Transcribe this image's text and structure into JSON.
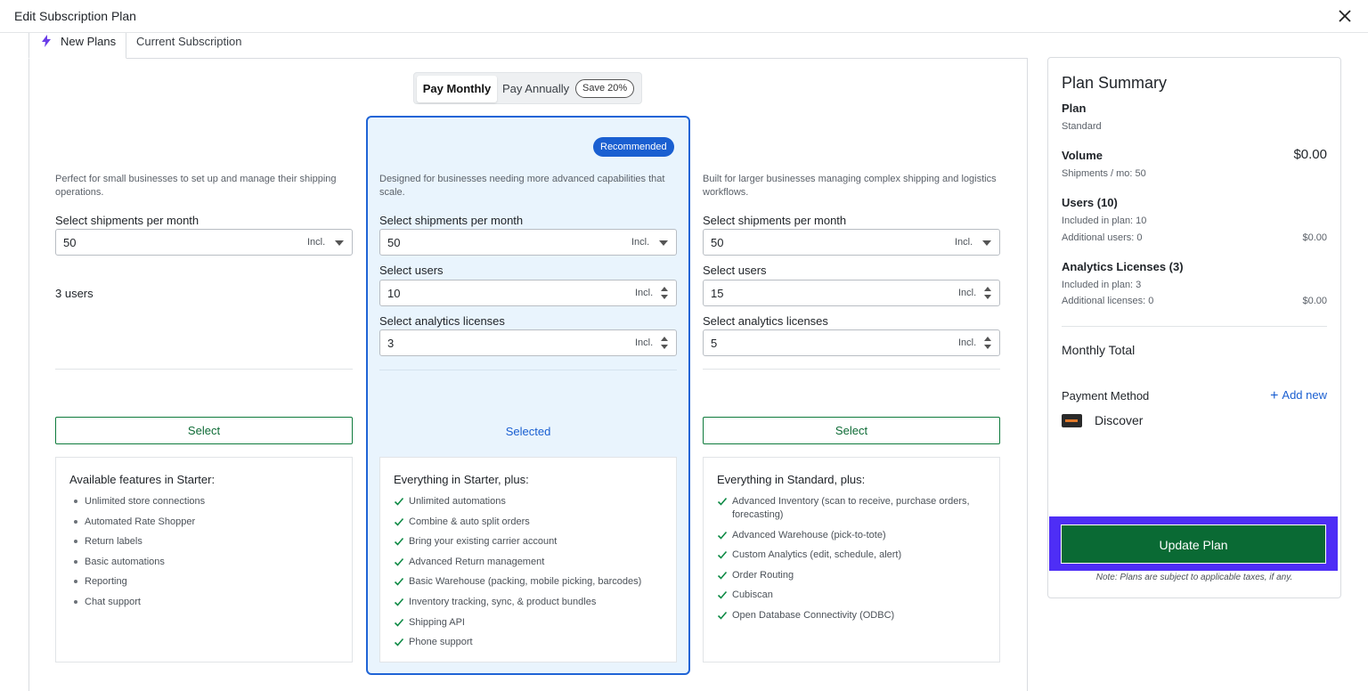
{
  "window": {
    "title": "Edit Subscription Plan"
  },
  "tabs": {
    "new_plans": "New Plans",
    "current_subscription": "Current Subscription"
  },
  "billing_toggle": {
    "monthly": "Pay Monthly",
    "annually": "Pay Annually",
    "save_badge": "Save 20%"
  },
  "plans": {
    "starter": {
      "description": "Perfect for small businesses to set up and manage their shipping operations.",
      "shipments_label": "Select shipments per month",
      "shipments_value": "50",
      "incl": "Incl.",
      "users_text": "3 users",
      "button": "Select",
      "features_heading": "Available features in Starter:",
      "features": [
        "Unlimited store connections",
        "Automated Rate Shopper",
        "Return labels",
        "Basic automations",
        "Reporting",
        "Chat support"
      ]
    },
    "standard": {
      "badge": "Recommended",
      "description": "Designed for businesses needing more advanced capabilities that scale.",
      "shipments_label": "Select shipments per month",
      "shipments_value": "50",
      "users_label": "Select users",
      "users_value": "10",
      "analytics_label": "Select analytics licenses",
      "analytics_value": "3",
      "incl": "Incl.",
      "selected_text": "Selected",
      "features_heading": "Everything in Starter, plus:",
      "features": [
        "Unlimited automations",
        "Combine & auto split orders",
        "Bring your existing carrier account",
        "Advanced Return management",
        "Basic Warehouse (packing, mobile picking, barcodes)",
        "Inventory tracking, sync, & product bundles",
        "Shipping API",
        "Phone support"
      ]
    },
    "pro": {
      "description": "Built for larger businesses managing complex shipping and logistics workflows.",
      "shipments_label": "Select shipments per month",
      "shipments_value": "50",
      "users_label": "Select users",
      "users_value": "15",
      "analytics_label": "Select analytics licenses",
      "analytics_value": "5",
      "incl": "Incl.",
      "button": "Select",
      "features_heading": "Everything in Standard, plus:",
      "features": [
        "Advanced Inventory (scan to receive, purchase orders, forecasting)",
        "Advanced Warehouse (pick-to-tote)",
        "Custom Analytics (edit, schedule, alert)",
        "Order Routing",
        "Cubiscan",
        "Open Database Connectivity (ODBC)"
      ]
    }
  },
  "summary": {
    "heading": "Plan Summary",
    "plan_label": "Plan",
    "plan_value": "Standard",
    "volume_label": "Volume",
    "volume_price": "$0.00",
    "volume_detail": "Shipments / mo: 50",
    "users_label": "Users (10)",
    "users_included": "Included in plan: 10",
    "users_additional": "Additional users: 0",
    "users_additional_price": "$0.00",
    "analytics_label": "Analytics Licenses (3)",
    "analytics_included": "Included in plan: 3",
    "analytics_additional": "Additional licenses: 0",
    "analytics_additional_price": "$0.00",
    "monthly_total_label": "Monthly Total",
    "payment_method_label": "Payment Method",
    "add_new": "Add new",
    "card_name": "Discover",
    "update_button": "Update Plan",
    "note": "Note: Plans are subject to applicable taxes, if any."
  },
  "colors": {
    "accent_blue": "#1a5fd1",
    "brand_green": "#0a6a34",
    "focus_ring": "#4e2ef6",
    "check_green": "#0e8a45"
  }
}
